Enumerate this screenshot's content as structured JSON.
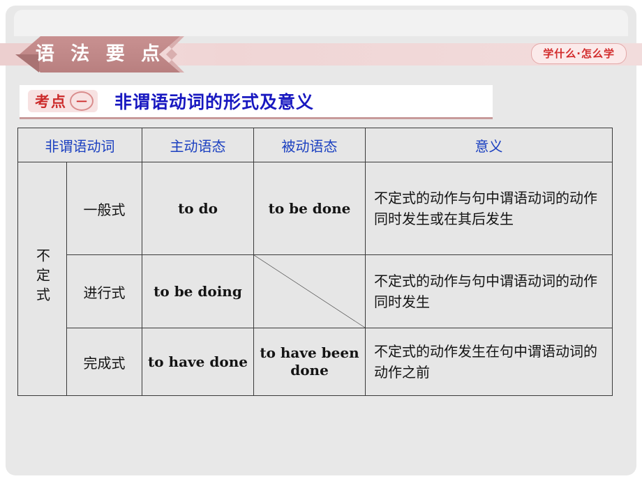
{
  "banner": {
    "title": "语 法 要 点"
  },
  "badge": {
    "label": "学什么·怎么学"
  },
  "heading": {
    "tag_label": "考点",
    "tag_number": "一",
    "title": "非谓语动词的形式及意义"
  },
  "colors": {
    "ribbon": "#c08888",
    "accent_red": "#cc2b2b",
    "title_blue": "#1818c0",
    "header_blue": "#1a3fc0",
    "panel_bg": "#e8e8e8",
    "table_bg": "#e6e6e6",
    "table_border": "#3a3a3a",
    "heading_underline": "#c79a9a"
  },
  "table": {
    "headers": [
      "非谓语动词",
      "主动语态",
      "被动语态",
      "意义"
    ],
    "group_label": "不定式",
    "rows": [
      {
        "form": "一般式",
        "active": "to do",
        "passive": "to be done",
        "passive_empty": false,
        "meaning": "不定式的动作与句中谓语动词的动作同时发生或在其后发生"
      },
      {
        "form": "进行式",
        "active": "to be doing",
        "passive": "",
        "passive_empty": true,
        "meaning": "不定式的动作与句中谓语动词的动作同时发生"
      },
      {
        "form": "完成式",
        "active": "to have done",
        "passive": "to have been done",
        "passive_empty": false,
        "meaning": "不定式的动作发生在句中谓语动词的动作之前"
      }
    ]
  }
}
